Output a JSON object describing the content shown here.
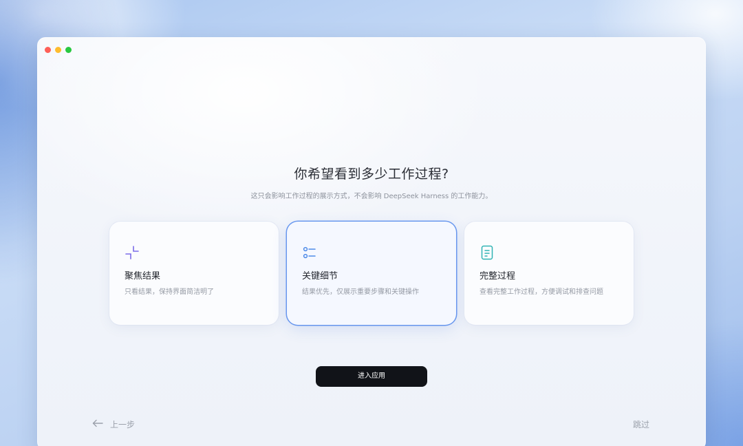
{
  "window": {
    "controls": [
      "close",
      "minimize",
      "maximize"
    ]
  },
  "heading": {
    "title": "你希望看到多少工作过程?",
    "subtitle": "这只会影响工作过程的展示方式，不会影响 DeepSeek Harness 的工作能力。"
  },
  "options": [
    {
      "icon": "collapse-icon",
      "title": "聚焦结果",
      "description": "只看结果，保持界面简洁明了",
      "selected": false
    },
    {
      "icon": "list-icon",
      "title": "关键细节",
      "description": "结果优先，仅展示重要步骤和关键操作",
      "selected": true
    },
    {
      "icon": "document-icon",
      "title": "完整过程",
      "description": "查看完整工作过程，方便调试和排查问题",
      "selected": false
    }
  ],
  "actions": {
    "enter_label": "进入应用",
    "back_label": "上一步",
    "skip_label": "跳过"
  },
  "colors": {
    "accent": "#6b9af0",
    "primary_button": "#111318",
    "icon_purple": "#7a6be8",
    "icon_blue": "#4d8ae8",
    "icon_teal": "#2fb3b3"
  }
}
